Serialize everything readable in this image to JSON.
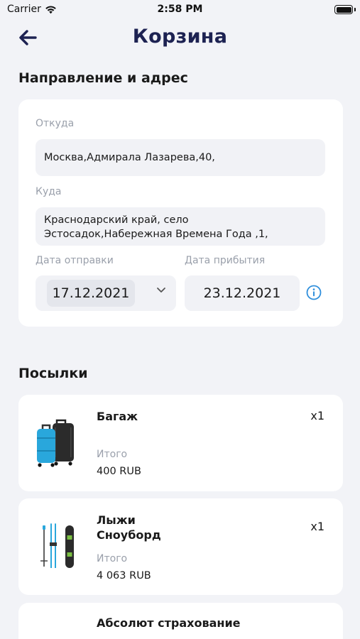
{
  "status_bar": {
    "carrier": "Carrier",
    "time": "2:58 PM"
  },
  "header": {
    "title": "Корзина"
  },
  "route_section": {
    "title": "Направление и адрес",
    "from_label": "Откуда",
    "from_value": "Москва,Адмирала Лазарева,40,",
    "to_label": "Куда",
    "to_value": "Краснодарский край,  село Эстосадок,Набережная Времена Года ,1,",
    "departure_label": "Дата отправки",
    "departure_value": "17.12.2021",
    "arrival_label": "Дата прибытия",
    "arrival_value": "23.12.2021"
  },
  "parcels_section": {
    "title": "Посылки",
    "items": [
      {
        "name": "Багаж",
        "quantity": "x1",
        "total_label": "Итого",
        "total_value": "400 RUB",
        "icon": "luggage-icon"
      },
      {
        "name": "Лыжи\nСноуборд",
        "quantity": "x1",
        "total_label": "Итого",
        "total_value": "4 063 RUB",
        "icon": "ski-snowboard-icon"
      },
      {
        "name": "Абсолют страхование"
      }
    ]
  },
  "colors": {
    "background": "#f2f3f7",
    "title": "#1d2252",
    "accent": "#2f8fdc",
    "muted": "#9aa0ab",
    "field": "#f1f2f6"
  }
}
